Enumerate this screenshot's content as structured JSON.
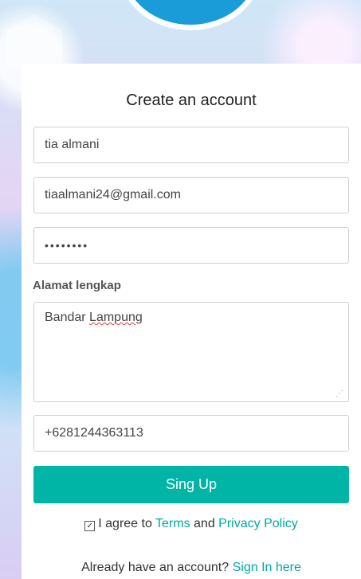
{
  "form": {
    "title": "Create an account",
    "name_value": "tia almani",
    "email_value": "tiaalmani24@gmail.com",
    "password_masked": "••••••••",
    "address_label": "Alamat lengkap",
    "address_value_part1": "Bandar ",
    "address_value_part2": "Lampung",
    "phone_value": "+6281244363113",
    "submit_label": "Sing Up",
    "agree_prefix": "I agree to ",
    "terms_link": "Terms",
    "agree_and": " and ",
    "privacy_link": "Privacy Policy",
    "agree_checked": true,
    "signin_prefix": "Already have an account? ",
    "signin_link": "Sign In here"
  },
  "colors": {
    "accent": "#00b5a5",
    "link": "#00a99d",
    "logo": "#1a9cd8"
  }
}
